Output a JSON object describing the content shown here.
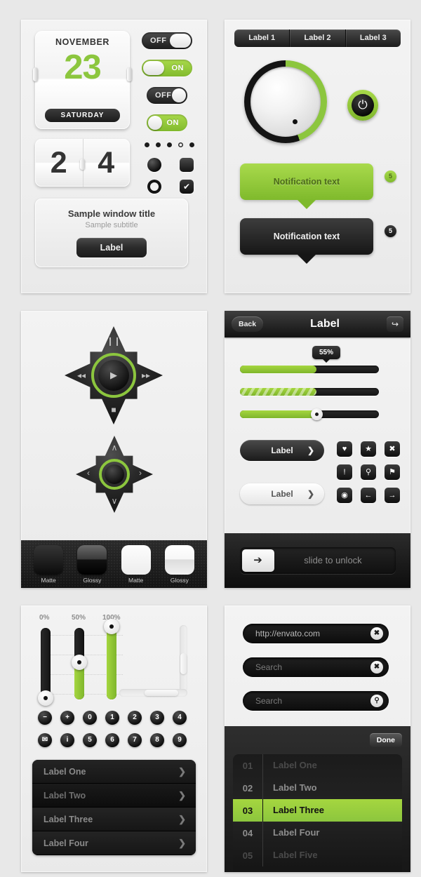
{
  "panel_calendar": {
    "calendar": {
      "month": "NOVEMBER",
      "day": "23",
      "weekday": "SATURDAY"
    },
    "flip_clock": {
      "left": "2",
      "right": "4"
    },
    "toggles": [
      {
        "label": "OFF",
        "state": "off",
        "shape": "square"
      },
      {
        "label": "ON",
        "state": "on",
        "shape": "square"
      },
      {
        "label": "OFF",
        "state": "off",
        "shape": "round"
      },
      {
        "label": "ON",
        "state": "on",
        "shape": "round"
      }
    ],
    "page_dots": {
      "count": 5,
      "active_index": 3
    },
    "controls": [
      "radio-filled",
      "square-filled",
      "radio-outline",
      "checkbox-checked"
    ],
    "checkbox_glyph": "✔",
    "window": {
      "title": "Sample window title",
      "subtitle": "Sample subtitle",
      "button": "Label"
    }
  },
  "panel_knob": {
    "tabs": [
      "Label 1",
      "Label 2",
      "Label 3"
    ],
    "power_glyph": "⏻",
    "notifications": [
      {
        "text": "Notification text",
        "style": "green",
        "badge": "5"
      },
      {
        "text": "Notification text",
        "style": "dark",
        "badge": "5"
      }
    ]
  },
  "panel_dpad": {
    "media_icons": {
      "up": "❙❙",
      "left": "◂◂",
      "right": "▸▸",
      "down": "■",
      "center": "▶"
    },
    "nav_icons": {
      "up": "∧",
      "left": "‹",
      "right": "›",
      "down": "∨"
    },
    "swatches": [
      {
        "name": "Matte",
        "style": "dark-matte"
      },
      {
        "name": "Glossy",
        "style": "dark-glossy"
      },
      {
        "name": "Matte",
        "style": "light-matte"
      },
      {
        "name": "Glossy",
        "style": "light-glossy"
      }
    ]
  },
  "panel_controls": {
    "navbar": {
      "back": "Back",
      "title": "Label",
      "share_glyph": "↪"
    },
    "progress": [
      {
        "percent": 55,
        "tooltip": "55%",
        "style": "solid"
      },
      {
        "percent": 55,
        "style": "striped"
      },
      {
        "percent": 55,
        "style": "handle"
      }
    ],
    "buttons": [
      {
        "label": "Label",
        "style": "dark",
        "arrow": "❯"
      },
      {
        "label": "Label",
        "style": "light",
        "arrow": "❯"
      }
    ],
    "icon_grid": [
      {
        "name": "heart-icon",
        "glyph": "♥"
      },
      {
        "name": "star-icon",
        "glyph": "★"
      },
      {
        "name": "close-icon",
        "glyph": "✖"
      },
      {
        "name": "alert-icon",
        "glyph": "!"
      },
      {
        "name": "search-icon",
        "glyph": "⚲"
      },
      {
        "name": "pin-icon",
        "glyph": "⚑"
      },
      {
        "name": "camera-icon",
        "glyph": "◉"
      },
      {
        "name": "arrow-left-icon",
        "glyph": "←"
      },
      {
        "name": "arrow-right-icon",
        "glyph": "→"
      }
    ],
    "unlock": {
      "text": "slide to unlock",
      "handle_glyph": "➔"
    }
  },
  "panel_sliders": {
    "labels": [
      "0%",
      "50%",
      "100%"
    ],
    "values": [
      0,
      50,
      100
    ],
    "number_buttons_row1": [
      "−",
      "+",
      "0",
      "1",
      "2",
      "3",
      "4"
    ],
    "number_buttons_row2": [
      "✉",
      "i",
      "5",
      "6",
      "7",
      "8",
      "9"
    ],
    "list": [
      {
        "label": "Label One",
        "selected": false
      },
      {
        "label": "Label Two",
        "selected": true
      },
      {
        "label": "Label Three",
        "selected": false
      },
      {
        "label": "Label Four",
        "selected": false
      }
    ],
    "list_arrow": "❯"
  },
  "panel_fields": {
    "fields": [
      {
        "value": "http://envato.com",
        "placeholder": false,
        "action": "clear-icon",
        "glyph": "✖"
      },
      {
        "value": "Search",
        "placeholder": true,
        "action": "clear-icon",
        "glyph": "✖"
      },
      {
        "value": "Search",
        "placeholder": true,
        "action": "search-icon",
        "glyph": "⚲"
      }
    ],
    "done_label": "Done",
    "picker_rows": [
      {
        "num": "01",
        "label": "Label One",
        "state": "dim"
      },
      {
        "num": "02",
        "label": "Label Two",
        "state": "normal"
      },
      {
        "num": "03",
        "label": "Label Three",
        "state": "active"
      },
      {
        "num": "04",
        "label": "Label Four",
        "state": "normal"
      },
      {
        "num": "05",
        "label": "Label Five",
        "state": "dim"
      }
    ]
  },
  "colors": {
    "accent_green": "#8cc63e",
    "dark": "#141414",
    "background": "#e8e8e8"
  }
}
